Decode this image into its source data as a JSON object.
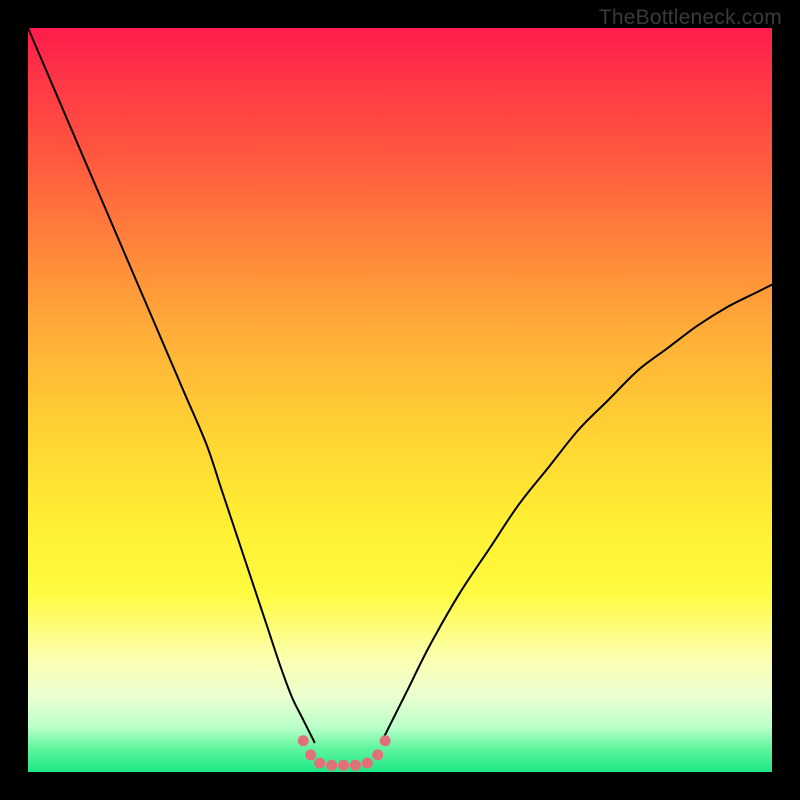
{
  "watermark": {
    "text": "TheBottleneck.com"
  },
  "chart_data": {
    "type": "line",
    "title": "",
    "xlabel": "",
    "ylabel": "",
    "xlim": [
      0,
      100
    ],
    "ylim": [
      0,
      100
    ],
    "grid": false,
    "legend": false,
    "series": [
      {
        "name": "left-curve",
        "stroke": "#000000",
        "stroke_width": 2,
        "x": [
          0,
          3,
          6,
          9,
          12,
          15,
          18,
          21,
          24,
          26,
          28,
          30,
          32,
          34,
          35.5,
          37,
          38.5
        ],
        "y": [
          100,
          93,
          86,
          79,
          72,
          65,
          58,
          51,
          44,
          38,
          32,
          26,
          20,
          14,
          10,
          7,
          4
        ]
      },
      {
        "name": "right-curve",
        "stroke": "#000000",
        "stroke_width": 2,
        "x": [
          47.5,
          49,
          51,
          54,
          58,
          62,
          66,
          70,
          74,
          78,
          82,
          86,
          90,
          94,
          98,
          100
        ],
        "y": [
          4,
          7,
          11,
          17,
          24,
          30,
          36,
          41,
          46,
          50,
          54,
          57,
          60,
          62.5,
          64.5,
          65.5
        ]
      },
      {
        "name": "valley-markers",
        "type": "scatter",
        "stroke": "#e2707b",
        "fill": "#e2707b",
        "marker_r": 5.5,
        "x": [
          37.0,
          38.0,
          39.2,
          40.8,
          42.4,
          44.0,
          45.6,
          47.0,
          48.0
        ],
        "y": [
          4.2,
          2.3,
          1.2,
          0.9,
          0.9,
          0.9,
          1.2,
          2.3,
          4.2
        ]
      }
    ],
    "background_gradient": {
      "orientation": "vertical",
      "stops": [
        {
          "pos": 0.0,
          "color": "#ff1c4b"
        },
        {
          "pos": 0.3,
          "color": "#ff873a"
        },
        {
          "pos": 0.55,
          "color": "#ffd433"
        },
        {
          "pos": 0.76,
          "color": "#fffb40"
        },
        {
          "pos": 0.9,
          "color": "#e9ffd1"
        },
        {
          "pos": 1.0,
          "color": "#1de885"
        }
      ]
    }
  }
}
